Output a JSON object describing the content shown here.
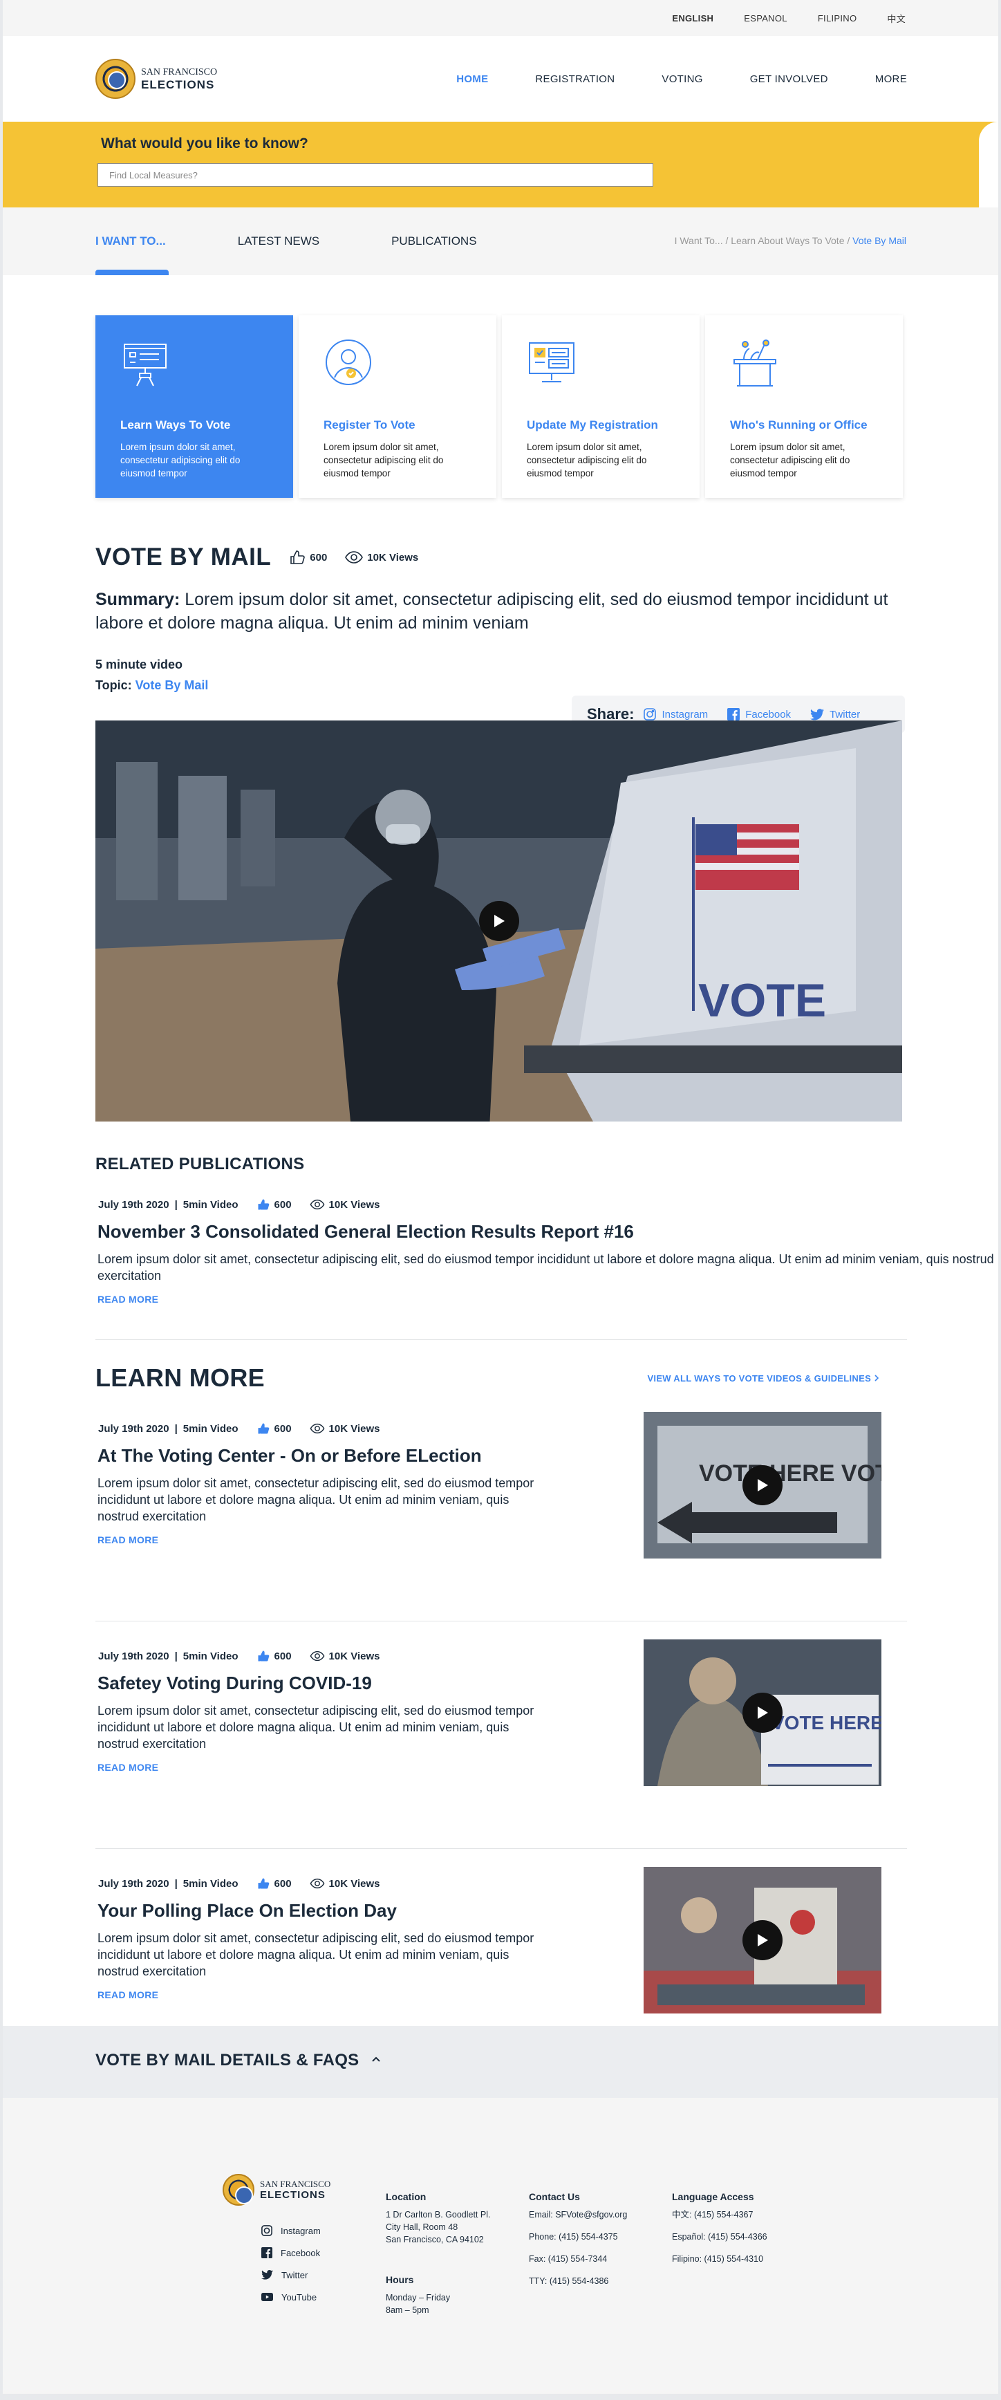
{
  "languages": [
    "ENGLISH",
    "ESPANOL",
    "FILIPINO",
    "中文"
  ],
  "logo": {
    "line1": "SAN FRANCISCO",
    "line2": "ELECTIONS"
  },
  "nav": [
    "HOME",
    "REGISTRATION",
    "VOTING",
    "GET INVOLVED",
    "MORE"
  ],
  "search": {
    "heading": "What would you like to know?",
    "placeholder": "Find Local Measures?"
  },
  "tabs": [
    "I WANT TO...",
    "LATEST NEWS",
    "PUBLICATIONS"
  ],
  "breadcrumb": {
    "part1": "I Want To...",
    "part2": "Learn About Ways To Vote",
    "current": "Vote By Mail",
    "sep": " / "
  },
  "cards": [
    {
      "title": "Learn Ways To Vote",
      "text": "Lorem ipsum dolor sit amet, consectetur adipiscing elit do eiusmod tempor",
      "icon": "presentation-board-icon"
    },
    {
      "title": "Register To Vote",
      "text": "Lorem ipsum dolor sit amet, consectetur adipiscing elit do eiusmod tempor",
      "icon": "user-check-icon"
    },
    {
      "title": "Update My Registration",
      "text": "Lorem ipsum dolor sit amet, consectetur adipiscing elit do eiusmod tempor",
      "icon": "monitor-form-icon"
    },
    {
      "title": "Who's Running or Office",
      "text": "Lorem ipsum dolor sit amet, consectetur adipiscing elit do eiusmod tempor",
      "icon": "podium-icon"
    }
  ],
  "article": {
    "title": "VOTE BY MAIL",
    "likes": "600",
    "views": "10K Views",
    "summary_label": "Summary:",
    "summary": " Lorem ipsum dolor sit amet, consectetur adipiscing elit, sed do eiusmod tempor incididunt ut labore et dolore magna aliqua. Ut enim ad minim veniam",
    "duration": "5 minute video",
    "topic_label": "Topic: ",
    "topic": "Vote By Mail",
    "share_label": "Share:",
    "share": [
      "Instagram",
      "Facebook",
      "Twitter"
    ],
    "video_sign": "VOTE"
  },
  "related": {
    "heading": "RELATED PUBLICATIONS",
    "items": [
      {
        "date": "July 19th 2020",
        "sep": "|",
        "type": "5min Video",
        "likes": "600",
        "views": "10K Views",
        "title": "November 3 Consolidated General Election Results Report #16",
        "text": "Lorem ipsum dolor sit amet, consectetur adipiscing elit, sed do eiusmod tempor incididunt ut labore et dolore magna aliqua. Ut enim ad minim veniam, quis nostrud exercitation",
        "read": "READ MORE"
      }
    ]
  },
  "learn": {
    "heading": "LEARN MORE",
    "view_all": "VIEW ALL WAYS TO VOTE VIDEOS & GUIDELINES",
    "items": [
      {
        "date": "July 19th 2020",
        "sep": "|",
        "type": "5min Video",
        "likes": "600",
        "views": "10K Views",
        "title": "At The Voting Center - On or Before ELection",
        "text": "Lorem ipsum dolor sit amet, consectetur adipiscing elit, sed do eiusmod tempor incididunt ut labore et dolore magna aliqua. Ut enim ad minim veniam, quis nostrud exercitation",
        "read": "READ MORE",
        "thumb_text": "VOTE HERE VOTE AQUÍ"
      },
      {
        "date": "July 19th 2020",
        "sep": "|",
        "type": "5min Video",
        "likes": "600",
        "views": "10K Views",
        "title": "Safetey Voting During COVID-19",
        "text": "Lorem ipsum dolor sit amet, consectetur adipiscing elit, sed do eiusmod tempor incididunt ut labore et dolore magna aliqua. Ut enim ad minim veniam, quis nostrud exercitation",
        "read": "READ MORE",
        "thumb_text": "VOTE HERE"
      },
      {
        "date": "July 19th 2020",
        "sep": "|",
        "type": "5min Video",
        "likes": "600",
        "views": "10K Views",
        "title": "Your Polling Place On Election Day",
        "text": "Lorem ipsum dolor sit amet, consectetur adipiscing elit, sed do eiusmod tempor incididunt ut labore et dolore magna aliqua. Ut enim ad minim veniam, quis nostrud exercitation",
        "read": "READ MORE",
        "thumb_text": ""
      }
    ]
  },
  "faq": {
    "heading": "VOTE BY MAIL DETAILS & FAQS"
  },
  "footer": {
    "social": [
      "Instagram",
      "Facebook",
      "Twitter",
      "YouTube"
    ],
    "location_h": "Location",
    "location": [
      "1 Dr Carlton B. Goodlett Pl.",
      "City Hall, Room 48",
      "San Francisco, CA 94102"
    ],
    "hours_h": "Hours",
    "hours": [
      "Monday – Friday",
      "8am – 5pm"
    ],
    "contact_h": "Contact Us",
    "contact": [
      "Email: SFVote@sfgov.org",
      "Phone: (415) 554-4375",
      "Fax: (415) 554-7344",
      "TTY: (415) 554-4386"
    ],
    "lang_h": "Language Access",
    "lang": [
      "中文: (415) 554-4367",
      "Español: (415) 554-4366",
      "Filipino: (415) 554-4310"
    ]
  },
  "colors": {
    "accent": "#3d86f0",
    "yellow": "#f5c335",
    "dark": "#1b2a3a"
  }
}
